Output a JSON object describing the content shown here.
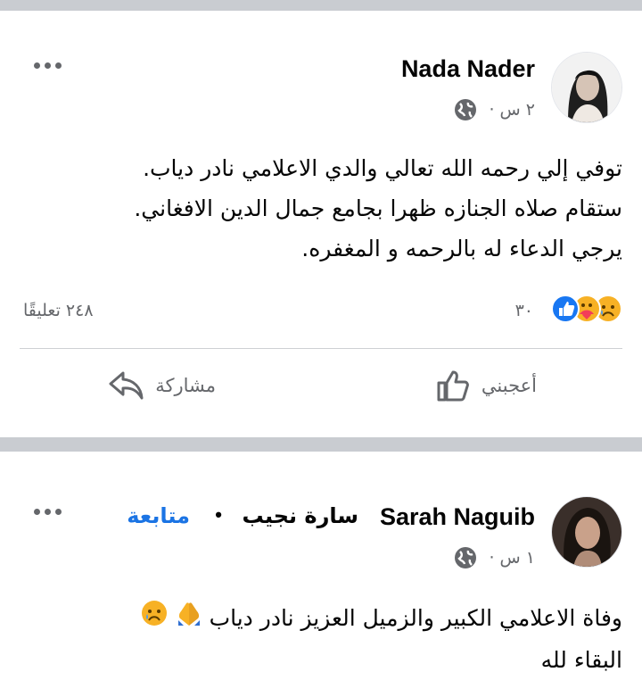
{
  "post1": {
    "author": "Nada Nader",
    "time": "٢ س",
    "body": [
      "توفي إلي رحمه الله تعالي والدي الاعلامي نادر دياب.",
      "ستقام صلاه الجنازه ظهرا بجامع جمال الدين الافغاني.",
      "يرجي الدعاء له بالرحمه و المغفره."
    ],
    "reaction_count": "٣٠",
    "reactions": [
      "sad",
      "care",
      "like"
    ],
    "comments": "٢٤٨ تعليقًا",
    "like_label": "أعجبني",
    "share_label": "مشاركة"
  },
  "post2": {
    "author": "Sarah Naguib",
    "author_ar": "سارة نجيب",
    "separator": "•",
    "follow_label": "متابعة",
    "time": "١ س",
    "body_line1": "وفاة الاعلامي الكبير والزميل العزيز نادر دياب",
    "body_line2": "البقاء لله",
    "emojis": [
      "folded-hands",
      "sad"
    ]
  },
  "colors": {
    "divider": "#c9ccd1",
    "secondary_text": "#65676b",
    "link_blue": "#1b74e4",
    "like_blue": "#1877f2"
  }
}
